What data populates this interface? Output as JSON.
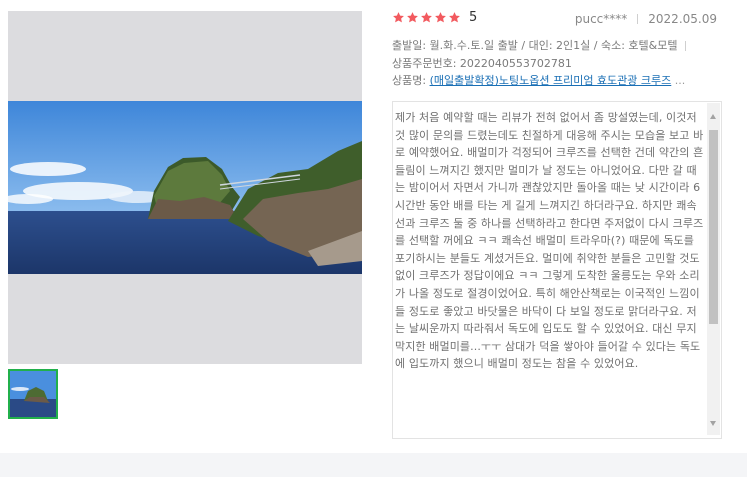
{
  "review": {
    "rating": "5",
    "stars": 5,
    "author": "pucc****",
    "date": "2022.05.09",
    "departure": "출발일: 월.화.수.토.일 출발 / 대인: 2인1실 / 숙소: 호텔&모텔",
    "order_number": "상품주문번호: 2022040553702781",
    "product_label": "상품명: ",
    "product_link": "(매일출발확정)노팅노옵션 프리미엄 효도관광 크루즈",
    "product_ellipsis": "...",
    "text": "제가 처음 예약할 때는 리뷰가 전혀 없어서 좀 망설였는데, 이것저것 많이 문의를 드렸는데도 친절하게 대응해 주시는 모습을 보고 바로 예약했어요. 배멀미가 걱정되어 크루즈를 선택한 건데 약간의 흔들림이 느껴지긴 했지만 멀미가 날 정도는 아니었어요. 다만 갈 때는 밤이어서 자면서 가니까 괜찮았지만 돌아올 때는 낮 시간이라 6시간반 동안 배를 타는 게 길게 느껴지긴 하더라구요. 하지만 쾌속선과 크루즈 둘 중 하나를 선택하라고 한다면 주저없이 다시 크루즈를 선택할 꺼에요 ㅋㅋ 쾌속선 배멀미 트라우마(?) 때문에 독도를 포기하시는 분들도 계셨거든요. 멀미에 취약한 분들은 고민할 것도 없이 크루즈가 정답이에요 ㅋㅋ 그렇게 도착한 울릉도는 우와 소리가 나올 정도로 절경이었어요. 특히 해안산책로는 이국적인 느낌이 들 정도로 좋았고 바닷물은 바닥이 다 보일 정도로 맑더라구요. 저는 날씨운까지 따라줘서 독도에 입도도 할 수 있었어요. 대신 무지막지한 배멀미를...ㅜㅜ 삼대가 덕을 쌓아야 들어갈 수 있다는 독도에 입도까지 했으니 배멀미 정도는 참을 수 있었어요."
  },
  "colors": {
    "star": "#f25a5f",
    "thumb_border": "#21b04b",
    "link": "#1a6fb5"
  }
}
